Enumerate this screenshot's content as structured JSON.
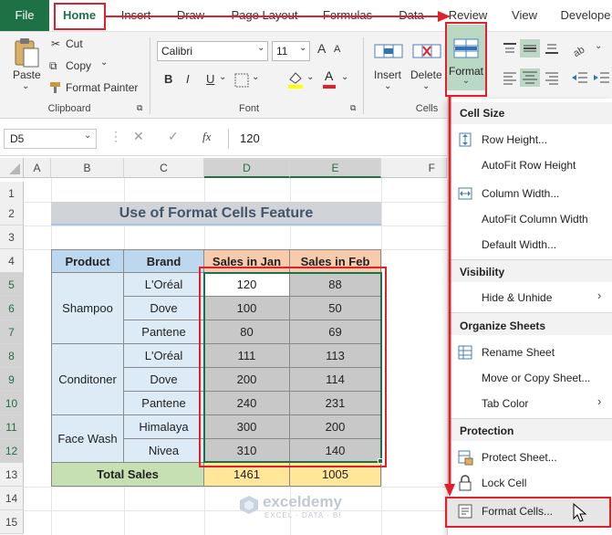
{
  "tabs": [
    "File",
    "Home",
    "Insert",
    "Draw",
    "Page Layout",
    "Formulas",
    "Data",
    "Review",
    "View",
    "Develope"
  ],
  "clipboard": {
    "paste": "Paste",
    "cut": "Cut",
    "copy": "Copy",
    "format_painter": "Format Painter",
    "label": "Clipboard"
  },
  "font": {
    "name": "Calibri",
    "size": "11",
    "label": "Font",
    "bold": "B",
    "italic": "I",
    "underline": "U",
    "grow": "A",
    "shrink": "A",
    "color_a": "A"
  },
  "cells_group": {
    "insert": "Insert",
    "delete": "Delete",
    "format": "Format",
    "label": "Cells"
  },
  "formula_bar": {
    "name_box": "D5",
    "fx": "fx",
    "value": "120"
  },
  "columns": [
    "A",
    "B",
    "C",
    "D",
    "E",
    "F"
  ],
  "rows": [
    "1",
    "2",
    "3",
    "4",
    "5",
    "6",
    "7",
    "8",
    "9",
    "10",
    "11",
    "12",
    "13",
    "14",
    "15"
  ],
  "sheet": {
    "title": "Use of Format Cells Feature",
    "headers": [
      "Product",
      "Brand",
      "Sales in Jan",
      "Sales in Feb"
    ],
    "products": [
      "Shampoo",
      "Conditoner",
      "Face Wash"
    ],
    "brands": [
      "L'Oréal",
      "Dove",
      "Pantene",
      "L'Oréal",
      "Dove",
      "Pantene",
      "Himalaya",
      "Nivea"
    ],
    "jan": [
      "120",
      "100",
      "80",
      "111",
      "200",
      "240",
      "300",
      "310"
    ],
    "feb": [
      "88",
      "50",
      "69",
      "113",
      "114",
      "231",
      "200",
      "140"
    ],
    "total_label": "Total Sales",
    "total_jan": "1461",
    "total_feb": "1005"
  },
  "menu": {
    "cell_size": "Cell Size",
    "row_height": "Row Height...",
    "autofit_row": "AutoFit Row Height",
    "column_width": "Column Width...",
    "autofit_column": "AutoFit Column Width",
    "default_width": "Default Width...",
    "visibility": "Visibility",
    "hide_unhide": "Hide & Unhide",
    "organize": "Organize Sheets",
    "rename": "Rename Sheet",
    "move_copy": "Move or Copy Sheet...",
    "tab_color": "Tab Color",
    "protection": "Protection",
    "protect_sheet": "Protect Sheet...",
    "lock_cell": "Lock Cell",
    "format_cells": "Format Cells..."
  },
  "watermark": {
    "name": "exceldemy",
    "tagline": "EXCEL · DATA · BI"
  },
  "colors": {
    "excel_green": "#1e7145",
    "annotation_red": "#e0202a",
    "header_blue": "#bdd7ee",
    "header_orange": "#f8cbad",
    "total_green": "#c6e0b4",
    "total_yellow": "#ffe699",
    "title_gray": "#d0d3d8",
    "selection_gray": "#c8c8c8"
  }
}
